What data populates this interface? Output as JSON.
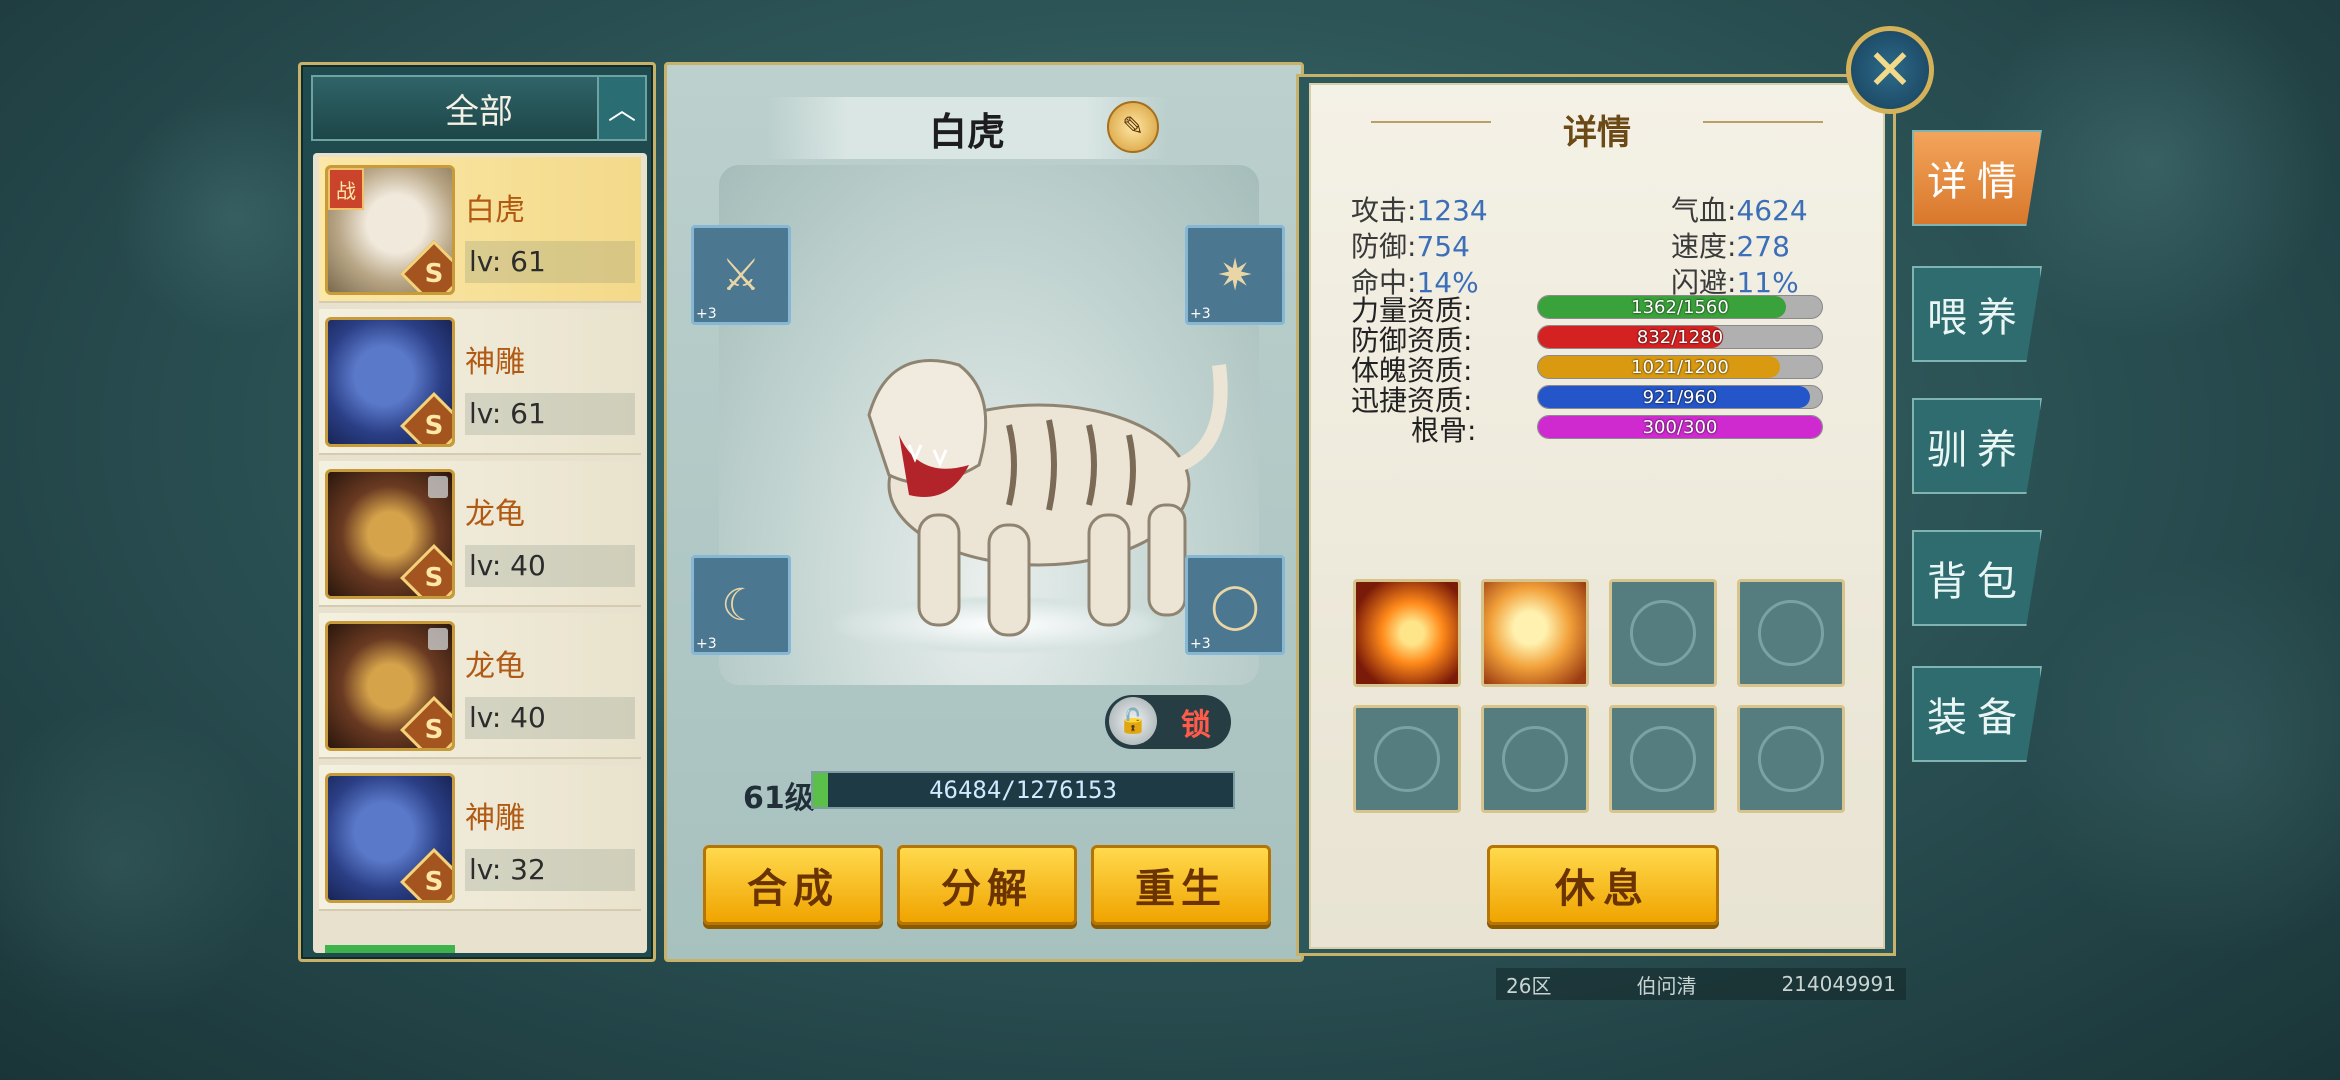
{
  "filter": {
    "label": "全部",
    "toggle_icon": "chevron-up-icon"
  },
  "pet_list": [
    {
      "name": "白虎",
      "level": "lv: 61",
      "grade": "S",
      "battle_tag": "战",
      "selected": true
    },
    {
      "name": "神雕",
      "level": "lv: 61",
      "grade": "S"
    },
    {
      "name": "龙龟",
      "level": "lv: 40",
      "grade": "S"
    },
    {
      "name": "龙龟",
      "level": "lv: 40",
      "grade": "S"
    },
    {
      "name": "神雕",
      "level": "lv: 32",
      "grade": "S"
    }
  ],
  "pet": {
    "name": "白虎",
    "lock_label": "锁",
    "level_label": "61级",
    "exp_text": "46484/1276153",
    "exp_fraction": 0.0364,
    "equip_plus": "+3"
  },
  "actions": {
    "combine": "合成",
    "decompose": "分解",
    "rebirth": "重生"
  },
  "details": {
    "title": "详情",
    "stats": {
      "attack_label": "攻击:",
      "attack": "1234",
      "hp_label": "气血:",
      "hp": "4624",
      "defense_label": "防御:",
      "defense": "754",
      "speed_label": "速度:",
      "speed": "278",
      "hit_label": "命中:",
      "hit": "14%",
      "dodge_label": "闪避:",
      "dodge": "11%"
    },
    "aptitudes": [
      {
        "label": "力量资质:",
        "text": "1362/1560",
        "fraction": 0.873,
        "color": "#3aa23a"
      },
      {
        "label": "防御资质:",
        "text": "832/1280",
        "fraction": 0.65,
        "color": "#d42222"
      },
      {
        "label": "体魄资质:",
        "text": "1021/1200",
        "fraction": 0.851,
        "color": "#d99a12"
      },
      {
        "label": "迅捷资质:",
        "text": "921/960",
        "fraction": 0.959,
        "color": "#2456c9"
      },
      {
        "label": "根骨:",
        "text": "300/300",
        "fraction": 1.0,
        "color": "#cf2ad0"
      }
    ],
    "rest_label": "休息"
  },
  "tabs": [
    "详情",
    "喂养",
    "驯养",
    "背包",
    "装备"
  ],
  "footer": {
    "server": "26区",
    "player": "伯问清",
    "id": "214049991"
  }
}
